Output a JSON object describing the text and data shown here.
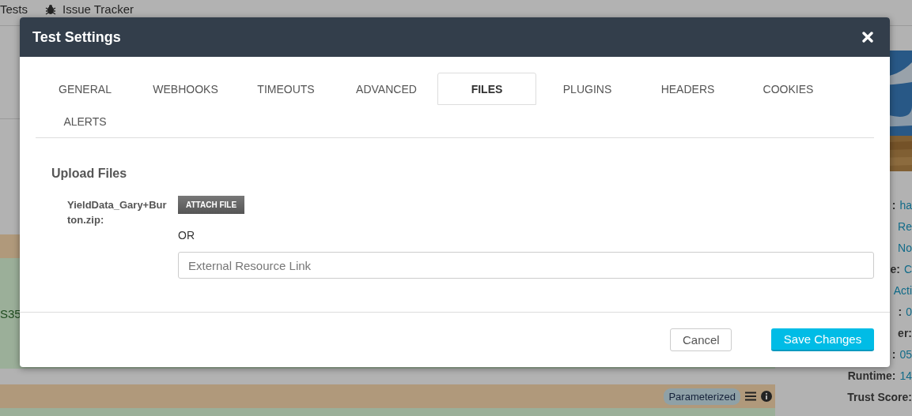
{
  "top_nav": {
    "items": [
      {
        "kind": "plain",
        "label": "Tests"
      },
      {
        "kind": "bug",
        "label": "Issue Tracker"
      }
    ]
  },
  "results_list": {
    "rows": [
      {
        "kind": "warning"
      },
      {
        "kind": "success",
        "text": "S35"
      },
      {
        "kind": "spacer"
      },
      {
        "kind": "warning",
        "badge": "Parameterized"
      },
      {
        "kind": "success"
      }
    ]
  },
  "details_panel": {
    "fields": [
      {
        "label": ":",
        "value": "ha"
      },
      {
        "value": "Re"
      },
      {
        "value": "No"
      },
      {
        "label": "e:",
        "value": "C"
      },
      {
        "value": "Acti"
      },
      {
        "label": ":",
        "value": "0"
      },
      {
        "label": "er:"
      },
      {
        "label": ":",
        "value": "05"
      },
      {
        "label": "Runtime:",
        "value": "14"
      },
      {
        "label": "Trust Score:"
      }
    ]
  },
  "dialog": {
    "title": "Test Settings",
    "tabs": [
      {
        "label": "GENERAL",
        "selected": false
      },
      {
        "label": "WEBHOOKS",
        "selected": false
      },
      {
        "label": "TIMEOUTS",
        "selected": false
      },
      {
        "label": "ADVANCED",
        "selected": false
      },
      {
        "label": "FILES",
        "selected": true
      },
      {
        "label": "PLUGINS",
        "selected": false
      },
      {
        "label": "HEADERS",
        "selected": false
      },
      {
        "label": "COOKIES",
        "selected": false
      },
      {
        "label": "ALERTS",
        "selected": false
      }
    ],
    "section_title": "Upload Files",
    "file_label": "YieldData_Gary+Burton.zip:",
    "attach_button": "ATTACH FILE",
    "or_text": "OR",
    "link_field": {
      "placeholder": "External Resource Link"
    },
    "buttons": [
      {
        "kind": "secondary",
        "label": "Cancel"
      },
      {
        "kind": "primary",
        "label": "Save Changes"
      }
    ]
  }
}
